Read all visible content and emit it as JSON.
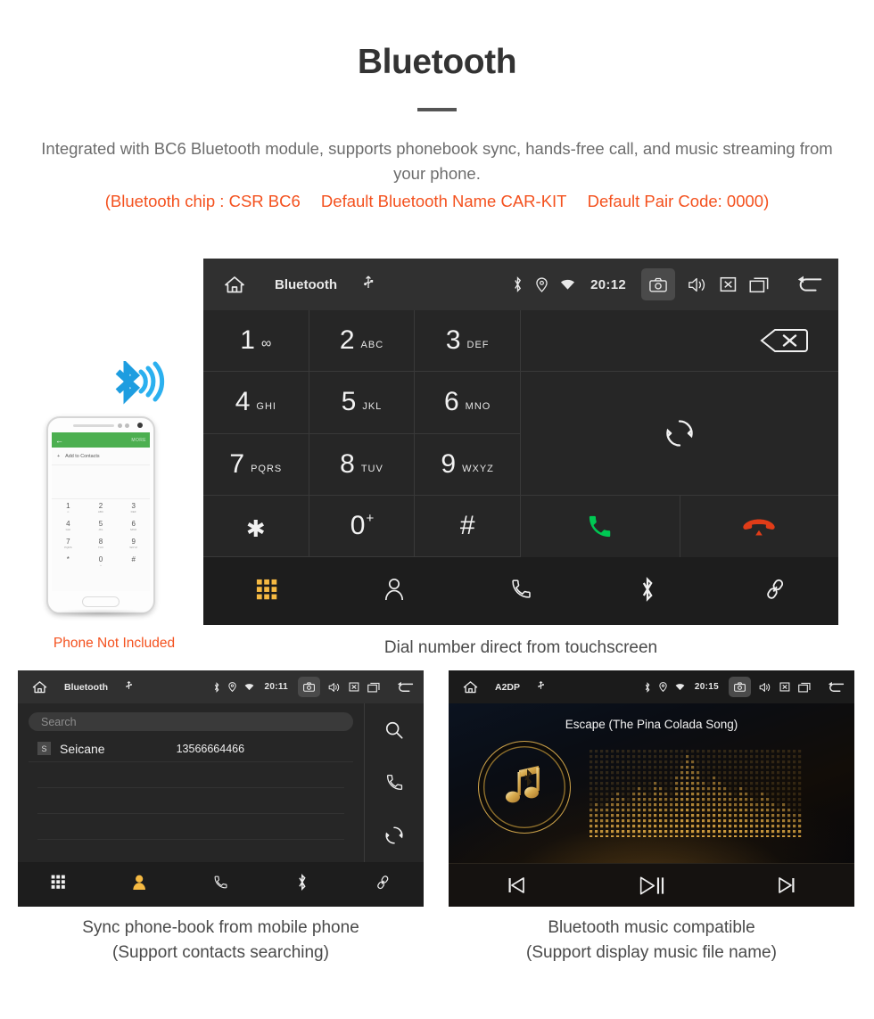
{
  "header": {
    "title": "Bluetooth",
    "subtitle": "Integrated with BC6 Bluetooth module, supports phonebook sync, hands-free call, and music streaming from your phone.",
    "note_chip": "(Bluetooth chip : CSR BC6",
    "note_name": "Default Bluetooth Name CAR-KIT",
    "note_pair": "Default Pair Code: 0000)",
    "accent_color": "#f4511e",
    "text_color": "#6d6d6d"
  },
  "main_screen": {
    "statusbar": {
      "home_icon": "home-icon",
      "title": "Bluetooth",
      "usb_icon": "usb-icon",
      "bluetooth_icon": "bluetooth-icon",
      "location_icon": "location-pin-icon",
      "wifi_icon": "wifi-icon",
      "time": "20:12",
      "camera_icon": "camera-icon",
      "volume_icon": "volume-icon",
      "mute_icon": "mute-icon",
      "recents_icon": "recent-apps-icon",
      "back_icon": "back-arrow-icon"
    },
    "keys": [
      {
        "num": "1",
        "sub": "∞",
        "is_voicemail": true
      },
      {
        "num": "2",
        "sub": "ABC"
      },
      {
        "num": "3",
        "sub": "DEF"
      },
      {
        "num": "4",
        "sub": "GHI"
      },
      {
        "num": "5",
        "sub": "JKL"
      },
      {
        "num": "6",
        "sub": "MNO"
      },
      {
        "num": "7",
        "sub": "PQRS"
      },
      {
        "num": "8",
        "sub": "TUV"
      },
      {
        "num": "9",
        "sub": "WXYZ"
      },
      {
        "num": "*",
        "sub": ""
      },
      {
        "num": "0",
        "sub": "+"
      },
      {
        "num": "#",
        "sub": ""
      }
    ],
    "backspace_icon": "backspace-icon",
    "sync_icon": "sync-icon",
    "call_icon": "call-answer-icon",
    "hangup_icon": "call-end-icon",
    "call_color": "#00c853",
    "hangup_color": "#e03c18",
    "navbar": [
      {
        "name": "dialpad",
        "icon": "dialpad-icon",
        "active": true
      },
      {
        "name": "contacts",
        "icon": "contacts-person-icon",
        "active": false
      },
      {
        "name": "call-log",
        "icon": "phone-handset-icon",
        "active": false
      },
      {
        "name": "bluetooth",
        "icon": "bluetooth-icon",
        "active": false
      },
      {
        "name": "link",
        "icon": "link-chain-icon",
        "active": false
      }
    ],
    "active_color": "#f5b942"
  },
  "phone_mockup": {
    "back_arrow": "←",
    "more_label": "MORE",
    "add_to_contacts": "Add to Contacts",
    "plus": "+",
    "keys": [
      {
        "num": "1",
        "sub": "∞"
      },
      {
        "num": "2",
        "sub": "ABC"
      },
      {
        "num": "3",
        "sub": "DEF"
      },
      {
        "num": "4",
        "sub": "GHI"
      },
      {
        "num": "5",
        "sub": "JKL"
      },
      {
        "num": "6",
        "sub": "MNO"
      },
      {
        "num": "7",
        "sub": "PQRS"
      },
      {
        "num": "8",
        "sub": "TUV"
      },
      {
        "num": "9",
        "sub": "WXYZ"
      },
      {
        "num": "*",
        "sub": ""
      },
      {
        "num": "0",
        "sub": "+"
      },
      {
        "num": "#",
        "sub": ""
      }
    ],
    "caption": "Phone Not Included",
    "caption_color": "#f4511e"
  },
  "captions": {
    "main": "Dial number direct from touchscreen",
    "left_line1": "Sync phone-book from mobile phone",
    "left_line2": "(Support contacts searching)",
    "right_line1": "Bluetooth music compatible",
    "right_line2": "(Support display music file name)"
  },
  "contacts_screen": {
    "statusbar": {
      "home_icon": "home-icon",
      "title": "Bluetooth",
      "usb_icon": "usb-icon",
      "time": "20:11",
      "camera_icon": "camera-icon"
    },
    "search_placeholder": "Search",
    "contact": {
      "initial": "S",
      "name": "Seicane",
      "number": "13566664466"
    },
    "side_actions": [
      {
        "name": "search",
        "icon": "search-magnifier-icon"
      },
      {
        "name": "dial",
        "icon": "phone-handset-icon"
      },
      {
        "name": "sync",
        "icon": "sync-icon"
      }
    ],
    "navbar": [
      {
        "name": "dialpad",
        "icon": "dialpad-icon",
        "active": false
      },
      {
        "name": "contacts",
        "icon": "contacts-person-icon",
        "active": true
      },
      {
        "name": "call-log",
        "icon": "phone-handset-icon",
        "active": false
      },
      {
        "name": "bluetooth",
        "icon": "bluetooth-icon",
        "active": false
      },
      {
        "name": "link",
        "icon": "link-chain-icon",
        "active": false
      }
    ]
  },
  "music_screen": {
    "statusbar": {
      "home_icon": "home-icon",
      "title": "A2DP",
      "usb_icon": "usb-icon",
      "time": "20:15",
      "camera_icon": "camera-icon"
    },
    "track_title": "Escape (The Pina Colada Song)",
    "album_art_icon": "music-note-bluetooth-icon",
    "controls": [
      {
        "name": "previous",
        "icon": "skip-previous-icon"
      },
      {
        "name": "play-pause",
        "icon": "play-pause-icon"
      },
      {
        "name": "next",
        "icon": "skip-next-icon"
      }
    ],
    "accent_color": "#d9a441"
  }
}
